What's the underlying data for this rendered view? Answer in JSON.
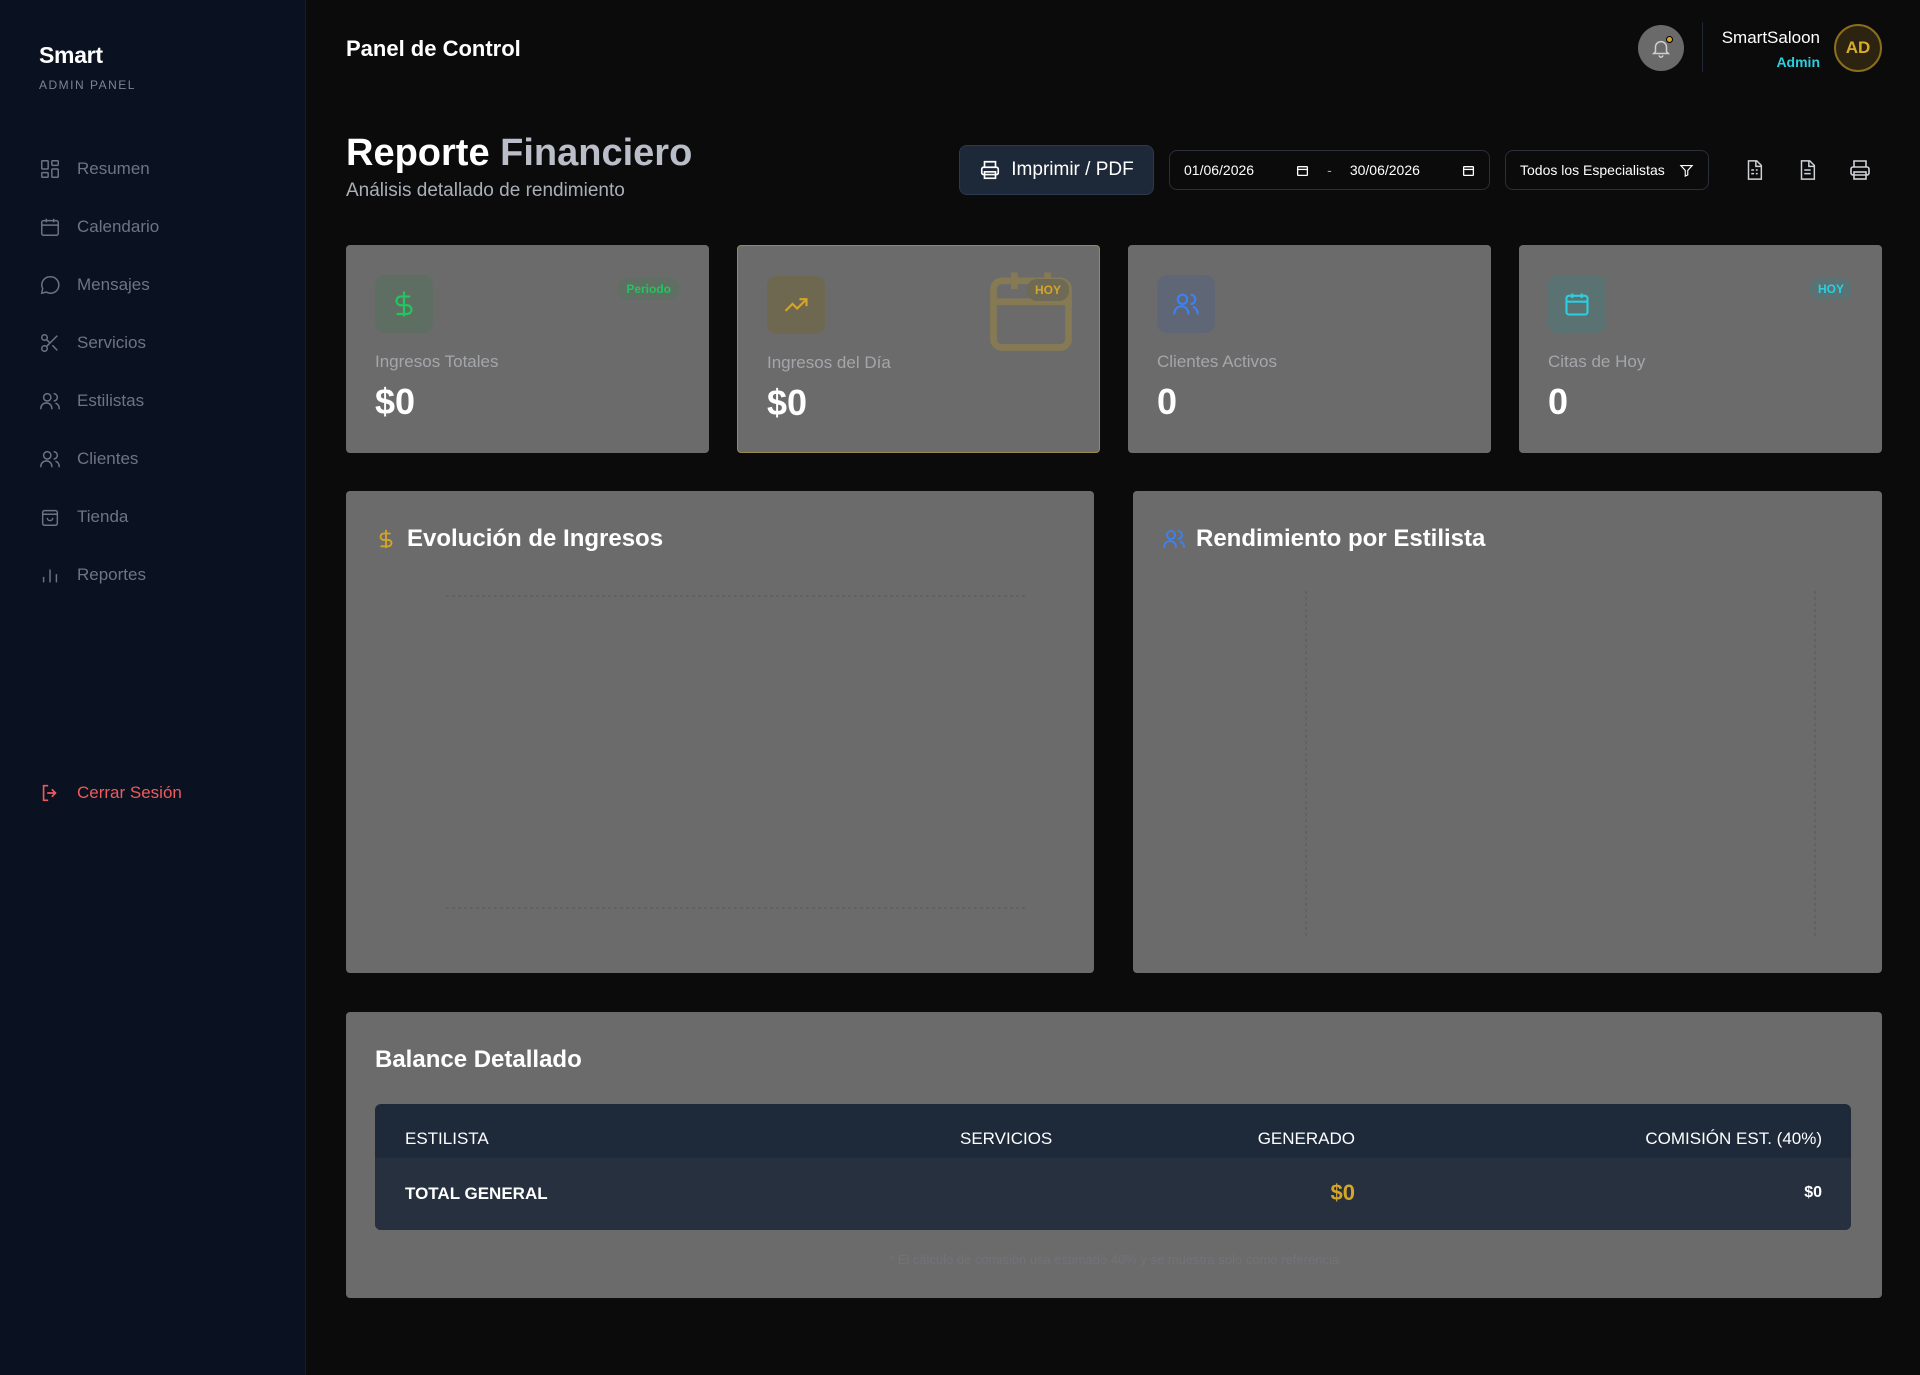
{
  "sidebar": {
    "brand": "Smart",
    "subtitle": "ADMIN PANEL",
    "items": [
      {
        "label": "Resumen",
        "icon": "grid-icon"
      },
      {
        "label": "Calendario",
        "icon": "calendar-icon"
      },
      {
        "label": "Mensajes",
        "icon": "message-icon"
      },
      {
        "label": "Servicios",
        "icon": "scissors-icon"
      },
      {
        "label": "Estilistas",
        "icon": "users-icon"
      },
      {
        "label": "Clientes",
        "icon": "users-icon"
      },
      {
        "label": "Tienda",
        "icon": "bag-icon"
      },
      {
        "label": "Reportes",
        "icon": "bar-chart-icon"
      }
    ],
    "logout": "Cerrar Sesión"
  },
  "topbar": {
    "title": "Panel de Control",
    "user_name": "SmartSaloon",
    "user_role": "Admin",
    "avatar_initials": "AD"
  },
  "header": {
    "title_main": "Reporte",
    "title_accent": "Financiero",
    "subtitle": "Análisis detallado de rendimiento",
    "print_label": "Imprimir / PDF",
    "date_from": "01/06/2026",
    "date_sep": "-",
    "date_to": "30/06/2026",
    "specialist_filter": "Todos los Especialistas"
  },
  "cards": [
    {
      "label": "Ingresos Totales",
      "value": "$0",
      "badge": "Periodo",
      "color": "#22c55e"
    },
    {
      "label": "Ingresos del Día",
      "value": "$0",
      "badge": "HOY",
      "color": "#d4a528"
    },
    {
      "label": "Clientes Activos",
      "value": "0",
      "badge": "",
      "color": "#3b82f6"
    },
    {
      "label": "Citas de Hoy",
      "value": "0",
      "badge": "HOY",
      "color": "#2ad0e0"
    }
  ],
  "charts": {
    "income_title": "Evolución de Ingresos",
    "stylist_title": "Rendimiento por Estilista"
  },
  "balance": {
    "title": "Balance Detallado",
    "columns": [
      "ESTILISTA",
      "SERVICIOS",
      "GENERADO",
      "COMISIÓN EST. (40%)"
    ],
    "total_label": "TOTAL GENERAL",
    "total_generated": "$0",
    "total_commission": "$0",
    "footnote": "* El cálculo de comisión usa estimado 40% y se muestra solo como referencia"
  },
  "colors": {
    "gold": "#d4a528",
    "cyan": "#2ad0e0",
    "danger": "#f05a5a",
    "card_bg": "#6b6b6b",
    "sidebar_bg": "#0a1120"
  }
}
